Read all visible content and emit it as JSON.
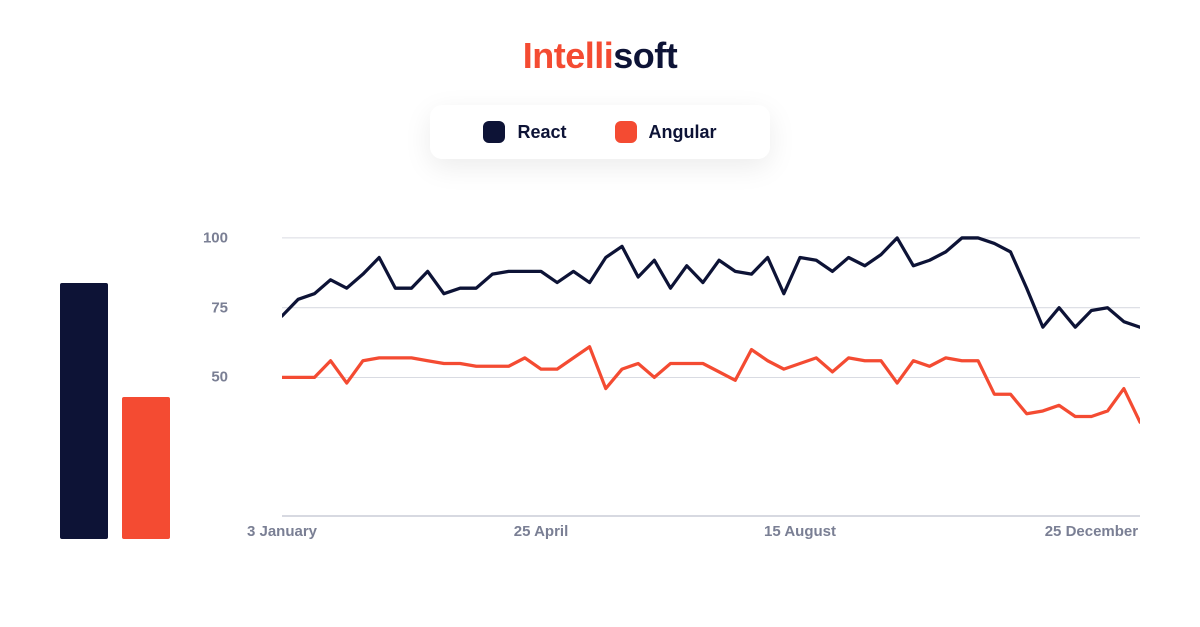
{
  "brand": {
    "a": "Intelli",
    "b": "soft"
  },
  "colors": {
    "react": "#0d1336",
    "angular": "#f44b32"
  },
  "legend": {
    "react": "React",
    "angular": "Angular"
  },
  "chart_data": {
    "type": "line",
    "ylabel": "",
    "xlabel": "",
    "ylim": [
      0,
      110
    ],
    "y_ticks": [
      50,
      75,
      100
    ],
    "x_tick_labels": [
      "3 January",
      "25 April",
      "15 August",
      "25 December"
    ],
    "x_tick_index": [
      0,
      16,
      32,
      50
    ],
    "series": [
      {
        "name": "React",
        "values": [
          72,
          78,
          80,
          85,
          82,
          87,
          93,
          82,
          82,
          88,
          80,
          82,
          82,
          87,
          88,
          88,
          88,
          84,
          88,
          84,
          93,
          97,
          86,
          92,
          82,
          90,
          84,
          92,
          88,
          87,
          93,
          80,
          93,
          92,
          88,
          93,
          90,
          94,
          100,
          90,
          92,
          95,
          100,
          100,
          98,
          95,
          82,
          68,
          75,
          68,
          74,
          75,
          70,
          68
        ]
      },
      {
        "name": "Angular",
        "values": [
          50,
          50,
          50,
          56,
          48,
          56,
          57,
          57,
          57,
          56,
          55,
          55,
          54,
          54,
          54,
          57,
          53,
          53,
          57,
          61,
          46,
          53,
          55,
          50,
          55,
          55,
          55,
          52,
          49,
          60,
          56,
          53,
          55,
          57,
          52,
          57,
          56,
          56,
          48,
          56,
          54,
          57,
          56,
          56,
          44,
          44,
          37,
          38,
          40,
          36,
          36,
          38,
          46,
          34
        ]
      }
    ],
    "bar_summary": {
      "react": 90,
      "angular": 50
    }
  }
}
